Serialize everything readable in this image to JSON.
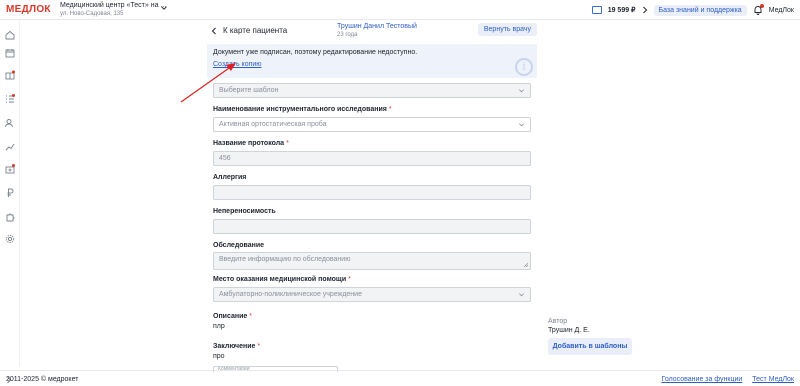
{
  "topbar": {
    "logo": "МЕДЛОК",
    "clinic_name": "Медицинский центр «Тест» на ...",
    "clinic_address": "ул. Ново-Садовая, 135",
    "balance": "19 599 ₽",
    "knowledge_base": "База знаний и поддержка",
    "brand_right": "МедЛок"
  },
  "header": {
    "back_label": "К карте пациента",
    "patient_name": "Трушин Данил Тестовый",
    "patient_age": "23 года",
    "return_button": "Вернуть врачу"
  },
  "notice": {
    "text": "Документ уже подписан, поэтому редактирование недоступно.",
    "copy_link": "Создать копию",
    "info_icon": "i"
  },
  "form": {
    "template_placeholder": "Выберите шаблон",
    "study_label": "Наименование инструментального исследования",
    "study_value": "Активная ортостатическая проба",
    "protocol_label": "Название протокола",
    "protocol_value": "456",
    "allergy_label": "Аллергия",
    "intolerance_label": "Непереносимость",
    "exam_label": "Обследование",
    "exam_placeholder": "Введите информацию по обследованию",
    "place_label": "Место оказания медицинской помощи",
    "place_value": "Амбулаторно-поликлиническое учреждение",
    "description_label": "Описание",
    "description_value": "плр",
    "conclusion_label": "Заключение",
    "conclusion_value": "про",
    "next_field_hint": "Комментарий"
  },
  "side": {
    "author_label": "Автор",
    "author_name": "Трушин Д. Е.",
    "add_template_button": "Добавить в шаблоны"
  },
  "footer": {
    "copyright": "2011-2025 © медрокет",
    "vote_link": "Голосование за функции",
    "test_link": "Тест МедЛок"
  },
  "colors": {
    "accent": "#2f5fc6",
    "brand_red": "#d9392b",
    "arrow": "#e02020"
  },
  "icons": [
    "home-icon",
    "calendar-icon",
    "gift-icon",
    "tasks-icon",
    "patients-icon",
    "analytics-icon",
    "medkit-icon",
    "ruble-icon",
    "puzzle-icon",
    "settings-icon",
    "expand-icon"
  ]
}
